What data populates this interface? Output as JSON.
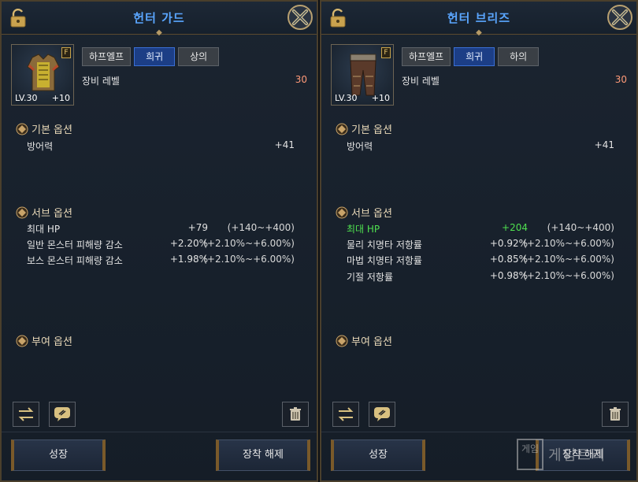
{
  "panels": [
    {
      "title": "헌터 가드",
      "item": {
        "level_label": "LV.30",
        "enhance": "+10",
        "grade_badge": "F",
        "icon": "armor-chest-icon"
      },
      "tags": [
        "하프엘프",
        "희귀",
        "상의"
      ],
      "equip_level_label": "장비 레벨",
      "equip_level_value": "30",
      "basic_title": "기본 옵션",
      "basic_options": [
        {
          "name": "방어력",
          "value": "+41"
        }
      ],
      "sub_title": "서브 옵션",
      "sub_options": [
        {
          "name": "최대 HP",
          "value": "+79",
          "range": "(+140~+400)"
        },
        {
          "name": "일반 몬스터 피해량 감소",
          "value": "+2.20%",
          "range": "(+2.10%~+6.00%)"
        },
        {
          "name": "보스 몬스터 피해량 감소",
          "value": "+1.98%",
          "range": "(+2.10%~+6.00%)"
        }
      ],
      "grant_title": "부여 옵션",
      "buttons": {
        "grow": "성장",
        "unequip": "장착 해제"
      }
    },
    {
      "title": "헌터 브리즈",
      "item": {
        "level_label": "LV.30",
        "enhance": "+10",
        "grade_badge": "F",
        "icon": "armor-pants-icon"
      },
      "tags": [
        "하프엘프",
        "희귀",
        "하의"
      ],
      "equip_level_label": "장비 레벨",
      "equip_level_value": "30",
      "basic_title": "기본 옵션",
      "basic_options": [
        {
          "name": "방어력",
          "value": "+41"
        }
      ],
      "sub_title": "서브 옵션",
      "sub_options": [
        {
          "name": "최대 HP",
          "value": "+204",
          "range": "(+140~+400)",
          "highlight": true
        },
        {
          "name": "물리 치명타 저항률",
          "value": "+0.92%",
          "range": "(+2.10%~+6.00%)"
        },
        {
          "name": "마법 치명타 저항률",
          "value": "+0.85%",
          "range": "(+2.10%~+6.00%)"
        },
        {
          "name": "기절 저항률",
          "value": "+0.98%",
          "range": "(+2.10%~+6.00%)"
        }
      ],
      "grant_title": "부여 옵션",
      "buttons": {
        "grow": "성장",
        "unequip": "장착 해제"
      }
    }
  ],
  "colors": {
    "title": "#5aa6ff",
    "rare_tag": "#1c3e86",
    "highlight": "#4fe04f",
    "level_value": "#ff9a78"
  },
  "watermark": {
    "box_text": "게임",
    "text": "게임트리"
  }
}
